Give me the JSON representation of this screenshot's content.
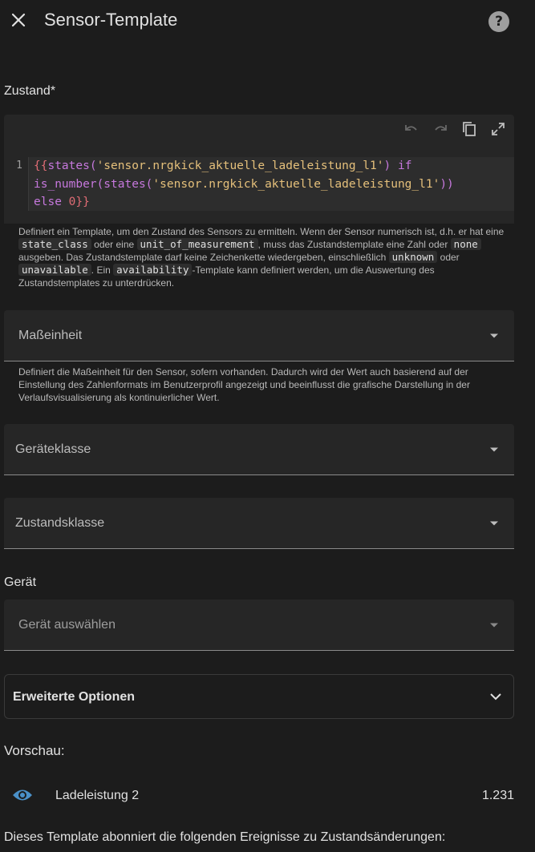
{
  "header": {
    "title": "Sensor-Template"
  },
  "state": {
    "label": "Zustand*",
    "line_number": "1",
    "code": {
      "t1": "{{",
      "t2": "states(",
      "t3": "'sensor.nrgkick_aktuelle_ladeleistung_l1'",
      "t4": ")",
      "t5": " if",
      "t6": "is_number(states(",
      "t7": "'sensor.nrgkick_aktuelle_ladeleistung_l1'",
      "t8": "))",
      "t9": "else ",
      "t10": "0",
      "t11": "}}"
    },
    "helper": {
      "p1": "Definiert ein Template, um den Zustand des Sensors zu ermitteln. Wenn der Sensor numerisch ist, d.h. er hat eine",
      "c1": "state_class",
      "p2": "oder eine",
      "c2": "unit_of_measurement",
      "p3": ", muss das Zustandstemplate eine Zahl oder",
      "c3": "none",
      "p4": "ausgeben. Das Zustandstemplate darf keine Zeichenkette wiedergeben, einschließlich",
      "c4": "unknown",
      "p5": "oder",
      "c5": "unavailable",
      "p6": ". Ein",
      "c6": "availability",
      "p7": "-Template kann definiert werden, um die Auswertung des Zustandstemplates zu unterdrücken."
    }
  },
  "unit": {
    "label": "Maßeinheit",
    "helper": "Definiert die Maßeinheit für den Sensor, sofern vorhanden. Dadurch wird der Wert auch basierend auf der Einstellung des Zahlenformats im Benutzerprofil angezeigt und beeinflusst die grafische Darstellung in der Verlaufsvisualisierung als kontinuierlicher Wert."
  },
  "device_class": {
    "label": "Geräteklasse"
  },
  "state_class": {
    "label": "Zustandsklasse"
  },
  "device": {
    "label": "Gerät",
    "placeholder": "Gerät auswählen"
  },
  "advanced": {
    "label": "Erweiterte Optionen"
  },
  "preview": {
    "label": "Vorschau:",
    "entity_name": "Ladeleistung 2",
    "entity_value": "1.231",
    "subscription_text": "Dieses Template abonniert die folgenden Ereignisse zu Zustandsänderungen:"
  },
  "colors": {
    "background": "#1c1c1c",
    "field": "#262626",
    "icon_accent": "#4a90c8"
  }
}
